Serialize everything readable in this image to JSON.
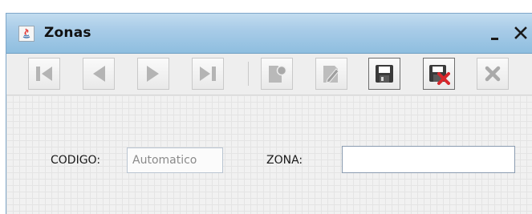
{
  "window": {
    "title": "Zonas"
  },
  "toolbar": {
    "buttons": [
      {
        "name": "first-record",
        "icon": "first-record-icon",
        "enabled": false
      },
      {
        "name": "previous-record",
        "icon": "previous-record-icon",
        "enabled": false
      },
      {
        "name": "next-record",
        "icon": "next-record-icon",
        "enabled": false
      },
      {
        "name": "last-record",
        "icon": "last-record-icon",
        "enabled": false
      },
      {
        "name": "new-record",
        "icon": "new-document-icon",
        "enabled": false
      },
      {
        "name": "edit-record",
        "icon": "edit-icon",
        "enabled": false
      },
      {
        "name": "save",
        "icon": "save-icon",
        "enabled": true
      },
      {
        "name": "cancel-save",
        "icon": "save-cancel-icon",
        "enabled": true
      },
      {
        "name": "delete",
        "icon": "delete-icon",
        "enabled": false
      }
    ]
  },
  "form": {
    "codigo_label": "CODIGO:",
    "codigo_value": "Automatico",
    "zona_label": "ZONA:",
    "zona_value": ""
  },
  "colors": {
    "titlebar": "#a9cce8",
    "disabled_icon": "#b4b4b4",
    "active_icon": "#3a3a3a",
    "delete_red": "#d8262b"
  }
}
